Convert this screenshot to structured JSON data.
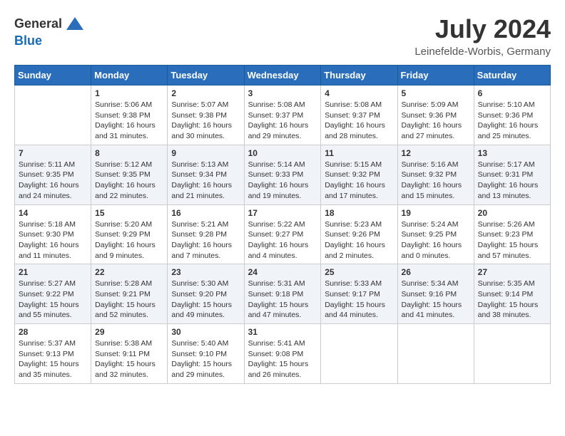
{
  "logo": {
    "general": "General",
    "blue": "Blue"
  },
  "title": {
    "month_year": "July 2024",
    "location": "Leinefelde-Worbis, Germany"
  },
  "header_days": [
    "Sunday",
    "Monday",
    "Tuesday",
    "Wednesday",
    "Thursday",
    "Friday",
    "Saturday"
  ],
  "weeks": [
    [
      {
        "day": "",
        "content": ""
      },
      {
        "day": "1",
        "content": "Sunrise: 5:06 AM\nSunset: 9:38 PM\nDaylight: 16 hours\nand 31 minutes."
      },
      {
        "day": "2",
        "content": "Sunrise: 5:07 AM\nSunset: 9:38 PM\nDaylight: 16 hours\nand 30 minutes."
      },
      {
        "day": "3",
        "content": "Sunrise: 5:08 AM\nSunset: 9:37 PM\nDaylight: 16 hours\nand 29 minutes."
      },
      {
        "day": "4",
        "content": "Sunrise: 5:08 AM\nSunset: 9:37 PM\nDaylight: 16 hours\nand 28 minutes."
      },
      {
        "day": "5",
        "content": "Sunrise: 5:09 AM\nSunset: 9:36 PM\nDaylight: 16 hours\nand 27 minutes."
      },
      {
        "day": "6",
        "content": "Sunrise: 5:10 AM\nSunset: 9:36 PM\nDaylight: 16 hours\nand 25 minutes."
      }
    ],
    [
      {
        "day": "7",
        "content": "Sunrise: 5:11 AM\nSunset: 9:35 PM\nDaylight: 16 hours\nand 24 minutes."
      },
      {
        "day": "8",
        "content": "Sunrise: 5:12 AM\nSunset: 9:35 PM\nDaylight: 16 hours\nand 22 minutes."
      },
      {
        "day": "9",
        "content": "Sunrise: 5:13 AM\nSunset: 9:34 PM\nDaylight: 16 hours\nand 21 minutes."
      },
      {
        "day": "10",
        "content": "Sunrise: 5:14 AM\nSunset: 9:33 PM\nDaylight: 16 hours\nand 19 minutes."
      },
      {
        "day": "11",
        "content": "Sunrise: 5:15 AM\nSunset: 9:32 PM\nDaylight: 16 hours\nand 17 minutes."
      },
      {
        "day": "12",
        "content": "Sunrise: 5:16 AM\nSunset: 9:32 PM\nDaylight: 16 hours\nand 15 minutes."
      },
      {
        "day": "13",
        "content": "Sunrise: 5:17 AM\nSunset: 9:31 PM\nDaylight: 16 hours\nand 13 minutes."
      }
    ],
    [
      {
        "day": "14",
        "content": "Sunrise: 5:18 AM\nSunset: 9:30 PM\nDaylight: 16 hours\nand 11 minutes."
      },
      {
        "day": "15",
        "content": "Sunrise: 5:20 AM\nSunset: 9:29 PM\nDaylight: 16 hours\nand 9 minutes."
      },
      {
        "day": "16",
        "content": "Sunrise: 5:21 AM\nSunset: 9:28 PM\nDaylight: 16 hours\nand 7 minutes."
      },
      {
        "day": "17",
        "content": "Sunrise: 5:22 AM\nSunset: 9:27 PM\nDaylight: 16 hours\nand 4 minutes."
      },
      {
        "day": "18",
        "content": "Sunrise: 5:23 AM\nSunset: 9:26 PM\nDaylight: 16 hours\nand 2 minutes."
      },
      {
        "day": "19",
        "content": "Sunrise: 5:24 AM\nSunset: 9:25 PM\nDaylight: 16 hours\nand 0 minutes."
      },
      {
        "day": "20",
        "content": "Sunrise: 5:26 AM\nSunset: 9:23 PM\nDaylight: 15 hours\nand 57 minutes."
      }
    ],
    [
      {
        "day": "21",
        "content": "Sunrise: 5:27 AM\nSunset: 9:22 PM\nDaylight: 15 hours\nand 55 minutes."
      },
      {
        "day": "22",
        "content": "Sunrise: 5:28 AM\nSunset: 9:21 PM\nDaylight: 15 hours\nand 52 minutes."
      },
      {
        "day": "23",
        "content": "Sunrise: 5:30 AM\nSunset: 9:20 PM\nDaylight: 15 hours\nand 49 minutes."
      },
      {
        "day": "24",
        "content": "Sunrise: 5:31 AM\nSunset: 9:18 PM\nDaylight: 15 hours\nand 47 minutes."
      },
      {
        "day": "25",
        "content": "Sunrise: 5:33 AM\nSunset: 9:17 PM\nDaylight: 15 hours\nand 44 minutes."
      },
      {
        "day": "26",
        "content": "Sunrise: 5:34 AM\nSunset: 9:16 PM\nDaylight: 15 hours\nand 41 minutes."
      },
      {
        "day": "27",
        "content": "Sunrise: 5:35 AM\nSunset: 9:14 PM\nDaylight: 15 hours\nand 38 minutes."
      }
    ],
    [
      {
        "day": "28",
        "content": "Sunrise: 5:37 AM\nSunset: 9:13 PM\nDaylight: 15 hours\nand 35 minutes."
      },
      {
        "day": "29",
        "content": "Sunrise: 5:38 AM\nSunset: 9:11 PM\nDaylight: 15 hours\nand 32 minutes."
      },
      {
        "day": "30",
        "content": "Sunrise: 5:40 AM\nSunset: 9:10 PM\nDaylight: 15 hours\nand 29 minutes."
      },
      {
        "day": "31",
        "content": "Sunrise: 5:41 AM\nSunset: 9:08 PM\nDaylight: 15 hours\nand 26 minutes."
      },
      {
        "day": "",
        "content": ""
      },
      {
        "day": "",
        "content": ""
      },
      {
        "day": "",
        "content": ""
      }
    ]
  ]
}
